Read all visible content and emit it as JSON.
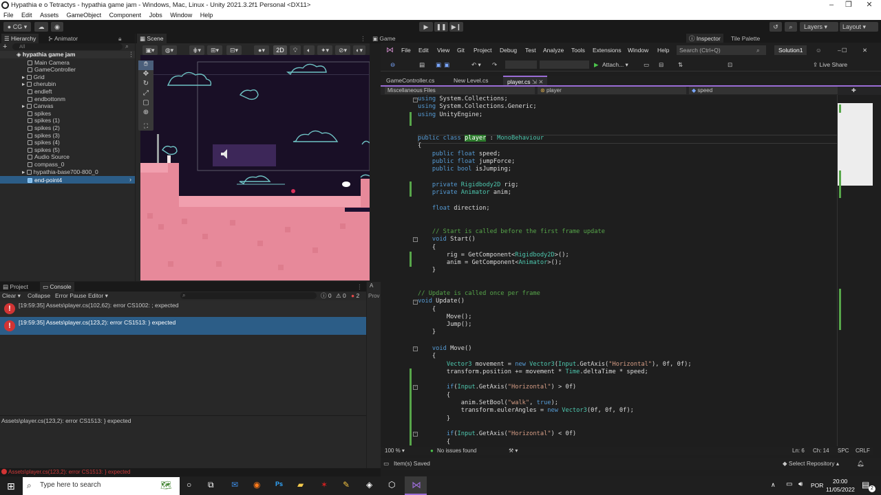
{
  "unity": {
    "title": "Hypathia e o Tetractys - hypathia game jam - Windows, Mac, Linux - Unity 2021.3.2f1 Personal <DX11>",
    "menu": [
      "File",
      "Edit",
      "Assets",
      "GameObject",
      "Component",
      "Jobs",
      "Window",
      "Help"
    ],
    "toolbar": {
      "account": "CG",
      "layers": "Layers",
      "layout": "Layout"
    },
    "tabs": {
      "hierarchy": "Hierarchy",
      "animator": "Animator",
      "scene": "Scene",
      "game": "Game",
      "inspector": "Inspector",
      "tile_palette": "Tile Palette",
      "project": "Project",
      "console": "Console"
    },
    "hierarchy": {
      "search_placeholder": "All",
      "root": "hypathia game jam",
      "items": [
        "Main Camera",
        "GameController",
        "Grid",
        "cherubin",
        "endleft",
        "endbottonm",
        "Canvas",
        "spikes",
        "spikes (1)",
        "spikes (2)",
        "spikes (3)",
        "spikes (4)",
        "spikes (5)",
        "Audio Source",
        "compass_0",
        "hypathia-base700-800_0",
        "end-point4"
      ]
    },
    "scene": {
      "mode_2d": "2D"
    },
    "console": {
      "buttons": [
        "Clear",
        "Collapse",
        "Error Pause",
        "Editor"
      ],
      "counts": {
        "info": "0",
        "warn": "0",
        "error": "2"
      },
      "messages": [
        "[19:59:35] Assets\\player.cs(102,62): error CS1002: ; expected",
        "[19:59:35] Assets\\player.cs(123,2): error CS1513: } expected"
      ],
      "detail": "Assets\\player.cs(123,2): error CS1513: } expected"
    },
    "status_error": "Assets\\player.cs(123,2): error CS1513: } expected",
    "side_label_1": "A",
    "side_label_2": "Prov"
  },
  "vs": {
    "menu": [
      "File",
      "Edit",
      "View",
      "Git",
      "Project",
      "Debug",
      "Test",
      "Analyze",
      "Tools",
      "Extensions",
      "Window",
      "Help"
    ],
    "search_placeholder": "Search (Ctrl+Q)",
    "solution": "Solution1",
    "attach": "Attach...",
    "live_share": "Live Share",
    "tabs": [
      "GameController.cs",
      "New Level.cs",
      "player.cs"
    ],
    "nav": {
      "project": "Miscellaneous Files",
      "class": "player",
      "member": "speed"
    },
    "status": {
      "zoom": "100 %",
      "issues": "No issues found",
      "ln": "Ln: 6",
      "ch": "Ch: 14",
      "spc": "SPC",
      "crlf": "CRLF",
      "saved": "Item(s) Saved",
      "repo": "Select Repository"
    }
  },
  "taskbar": {
    "search_placeholder": "Type here to search",
    "lang": "POR",
    "time": "20:00",
    "date": "11/05/2022",
    "notif_count": "2"
  },
  "colors": {
    "unity_bg": "#282828",
    "vs_bg": "#1e1e1e",
    "selection": "#2c5d87",
    "error_red": "#d13434",
    "pink_ground": "#e7899a"
  }
}
